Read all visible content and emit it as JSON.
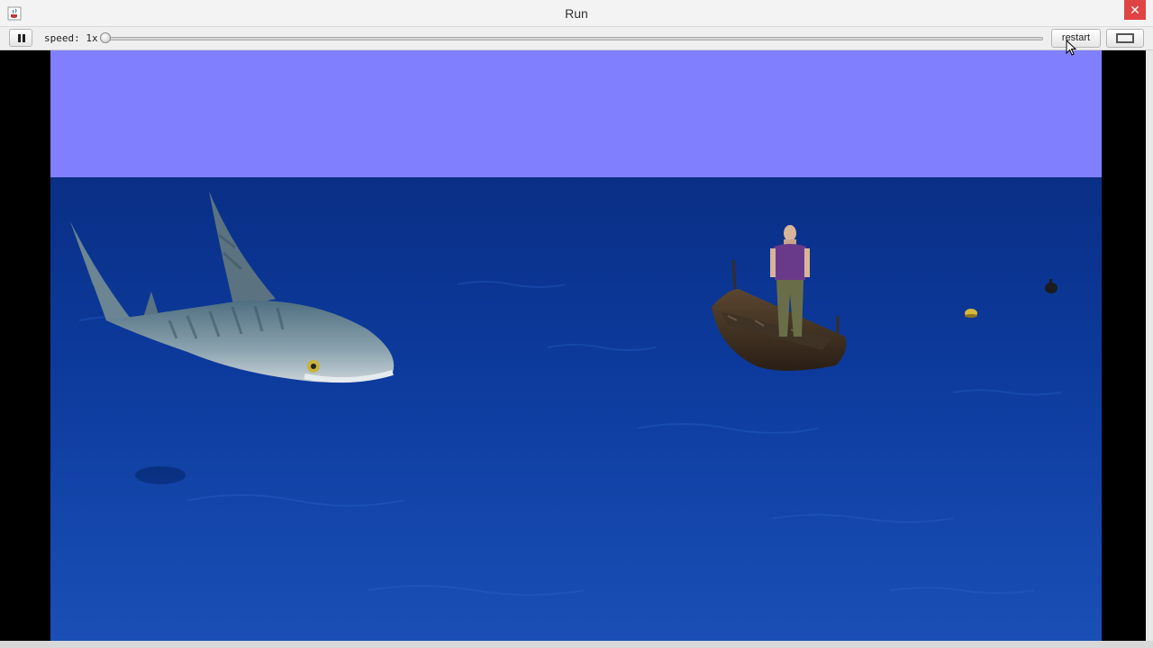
{
  "window": {
    "title": "Run",
    "close_glyph": "✕",
    "app_icon": "java-cup-icon"
  },
  "toolbar": {
    "pause_icon": "pause-icon",
    "speed_label": "speed: 1x",
    "speed_value": 1,
    "speed_slider_fraction": 0,
    "restart_label": "restart",
    "fullscreen_icon": "fullscreen-icon"
  },
  "scene": {
    "sky_color": "#8080ff",
    "water_color": "#0b3fa3",
    "letterbox_color": "#000000",
    "objects": [
      "shark",
      "rowboat",
      "man",
      "buoy",
      "floating-object"
    ]
  }
}
